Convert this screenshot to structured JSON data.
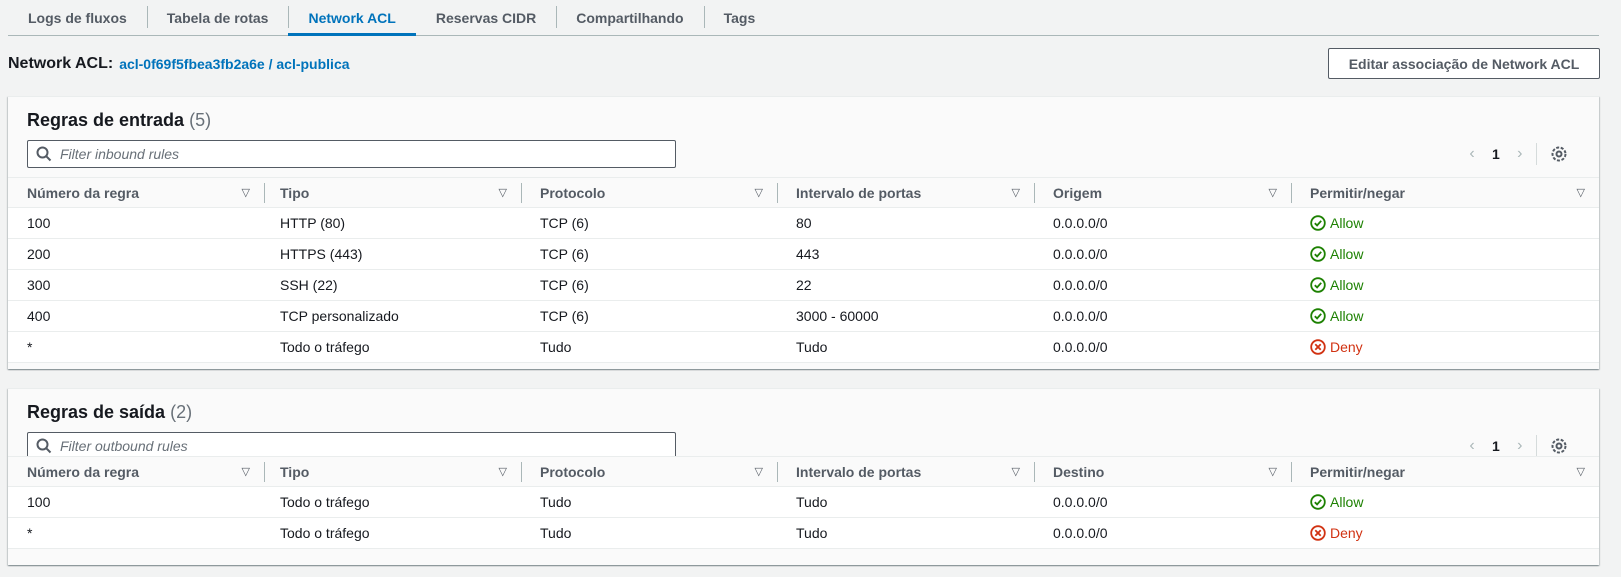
{
  "tabs": [
    {
      "label": "Logs de fluxos",
      "active": false
    },
    {
      "label": "Tabela de rotas",
      "active": false
    },
    {
      "label": "Network ACL",
      "active": true
    },
    {
      "label": "Reservas CIDR",
      "active": false
    },
    {
      "label": "Compartilhando",
      "active": false
    },
    {
      "label": "Tags",
      "active": false
    }
  ],
  "header": {
    "label": "Network ACL:",
    "acl_link": "acl-0f69f5fbea3fb2a6e / acl-publica",
    "edit_button": "Editar associação de Network ACL"
  },
  "inbound": {
    "title": "Regras de entrada",
    "count": "(5)",
    "filter_placeholder": "Filter inbound rules",
    "page": "1",
    "columns": [
      "Número da regra",
      "Tipo",
      "Protocolo",
      "Intervalo de portas",
      "Origem",
      "Permitir/negar"
    ],
    "rows": [
      {
        "rule": "100",
        "type": "HTTP (80)",
        "protocol": "TCP (6)",
        "ports": "80",
        "source": "0.0.0.0/0",
        "action": "Allow"
      },
      {
        "rule": "200",
        "type": "HTTPS (443)",
        "protocol": "TCP (6)",
        "ports": "443",
        "source": "0.0.0.0/0",
        "action": "Allow"
      },
      {
        "rule": "300",
        "type": "SSH (22)",
        "protocol": "TCP (6)",
        "ports": "22",
        "source": "0.0.0.0/0",
        "action": "Allow"
      },
      {
        "rule": "400",
        "type": "TCP personalizado",
        "protocol": "TCP (6)",
        "ports": "3000 - 60000",
        "source": "0.0.0.0/0",
        "action": "Allow"
      },
      {
        "rule": "*",
        "type": "Todo o tráfego",
        "protocol": "Tudo",
        "ports": "Tudo",
        "source": "0.0.0.0/0",
        "action": "Deny"
      }
    ]
  },
  "outbound": {
    "title": "Regras de saída",
    "count": "(2)",
    "filter_placeholder": "Filter outbound rules",
    "page": "1",
    "columns": [
      "Número da regra",
      "Tipo",
      "Protocolo",
      "Intervalo de portas",
      "Destino",
      "Permitir/negar"
    ],
    "rows": [
      {
        "rule": "100",
        "type": "Todo o tráfego",
        "protocol": "Tudo",
        "ports": "Tudo",
        "source": "0.0.0.0/0",
        "action": "Allow"
      },
      {
        "rule": "*",
        "type": "Todo o tráfego",
        "protocol": "Tudo",
        "ports": "Tudo",
        "source": "0.0.0.0/0",
        "action": "Deny"
      }
    ]
  },
  "colors": {
    "accent": "#0073bb",
    "allow": "#1d8102",
    "deny": "#d13212"
  }
}
